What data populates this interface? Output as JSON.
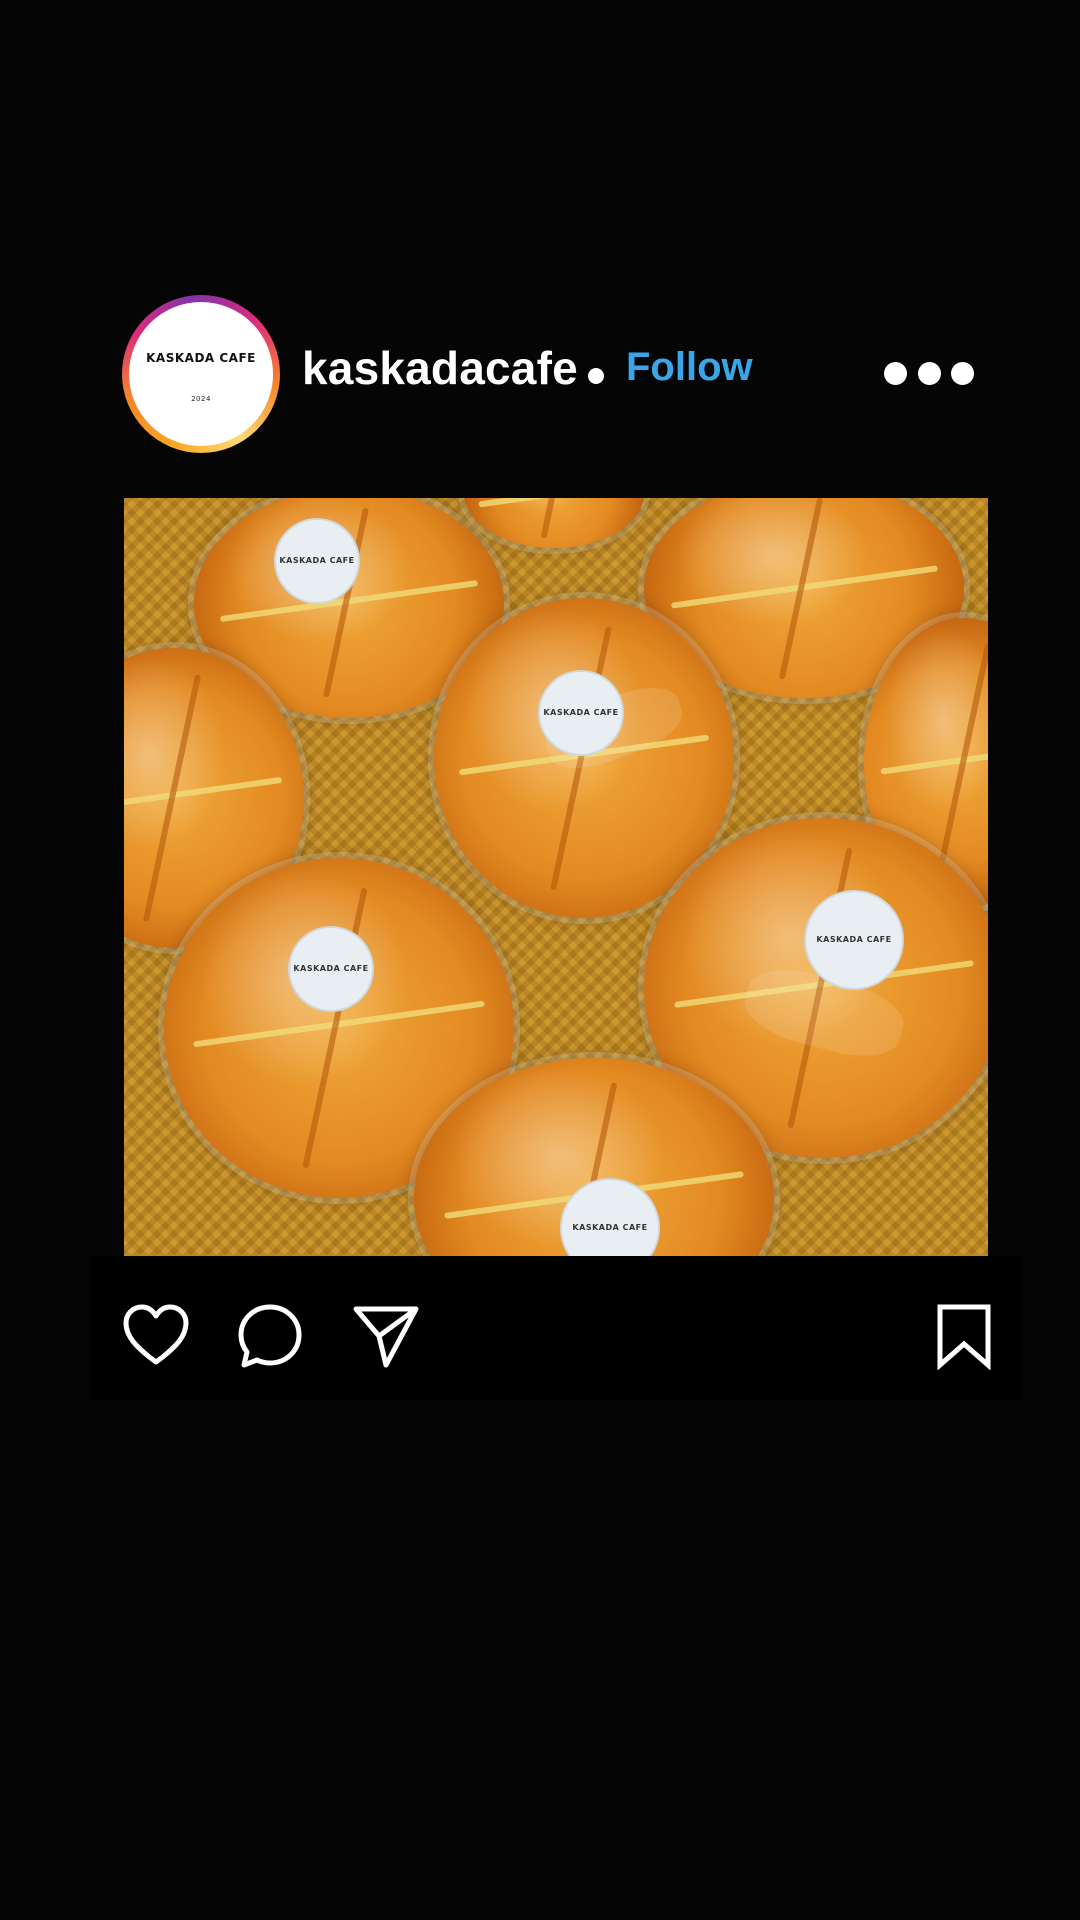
{
  "post": {
    "avatar": {
      "name": "KASKADA CAFE",
      "year": "2024"
    },
    "username": "kaskadacafe",
    "follow_label": "Follow",
    "follow_color": "#3aa6e8",
    "more_icon": "more-horizontal-icon"
  },
  "photo": {
    "sticker_text": "KASKADA CAFE"
  },
  "actions": {
    "icons": [
      "heart-icon",
      "comment-icon",
      "share-icon",
      "bookmark-icon"
    ]
  }
}
